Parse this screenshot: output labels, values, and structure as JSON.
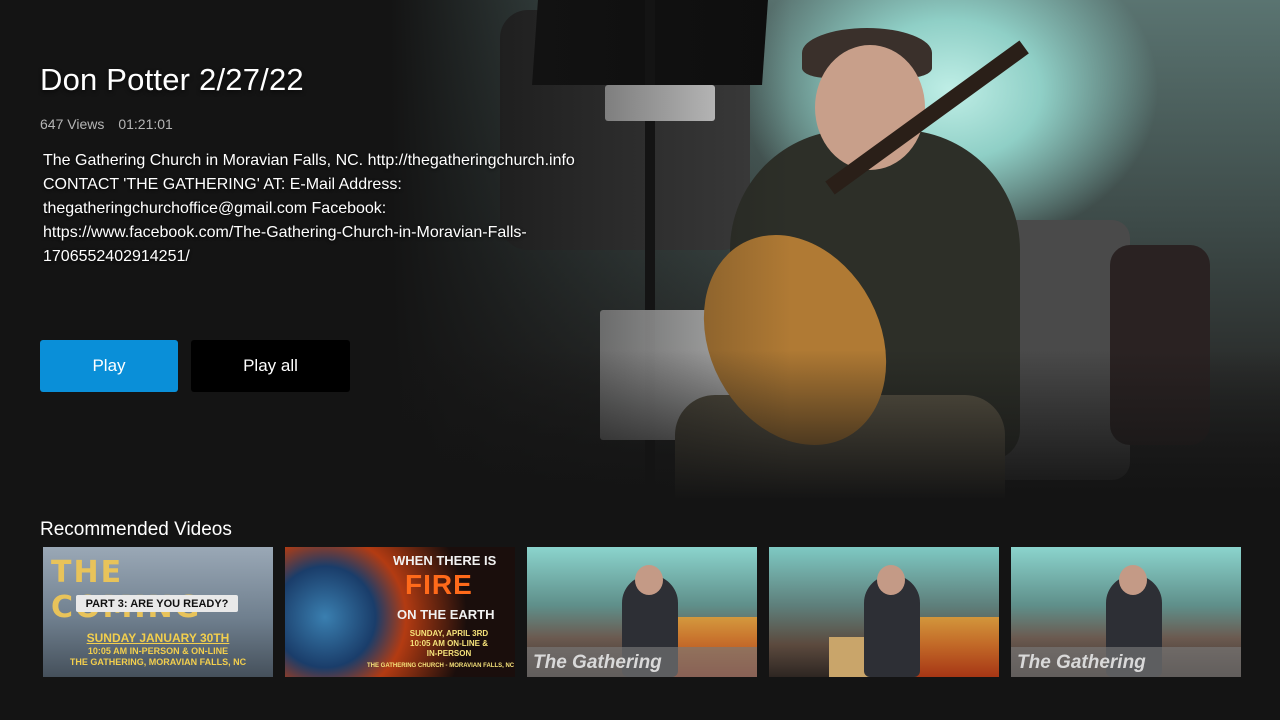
{
  "video": {
    "title": "Don Potter 2/27/22",
    "views": "647 Views",
    "duration": "01:21:01",
    "description": "The Gathering Church in Moravian Falls, NC. http://thegatheringchurch.info CONTACT 'THE GATHERING' AT: E-Mail Address: thegatheringchurchoffice@gmail.com Facebook: https://www.facebook.com/The-Gathering-Church-in-Moravian-Falls-1706552402914251/"
  },
  "actions": {
    "play_label": "Play",
    "play_all_label": "Play all"
  },
  "colors": {
    "background": "#141414",
    "accent": "#0a8fd8"
  },
  "recommended": {
    "heading": "Recommended Videos",
    "thumb1": {
      "headline": "THE COMING",
      "subtitle": "PART 3:  ARE YOU READY?",
      "date": "SUNDAY JANUARY 30TH",
      "time": "10:05 AM IN-PERSON & ON-LINE",
      "place": "THE GATHERING, MORAVIAN FALLS, NC"
    },
    "thumb2": {
      "line1": "WHEN THERE IS",
      "line2": "FIRE",
      "line3": "ON THE EARTH",
      "details": "SUNDAY, APRIL 3RD 10:05 AM ON-LINE & IN-PERSON",
      "footer": "THE GATHERING CHURCH - MORAVIAN FALLS, NC"
    },
    "thumb3": {
      "caption": "The Gathering"
    },
    "thumb4": {
      "caption": ""
    },
    "thumb5": {
      "caption": "The Gathering"
    }
  }
}
